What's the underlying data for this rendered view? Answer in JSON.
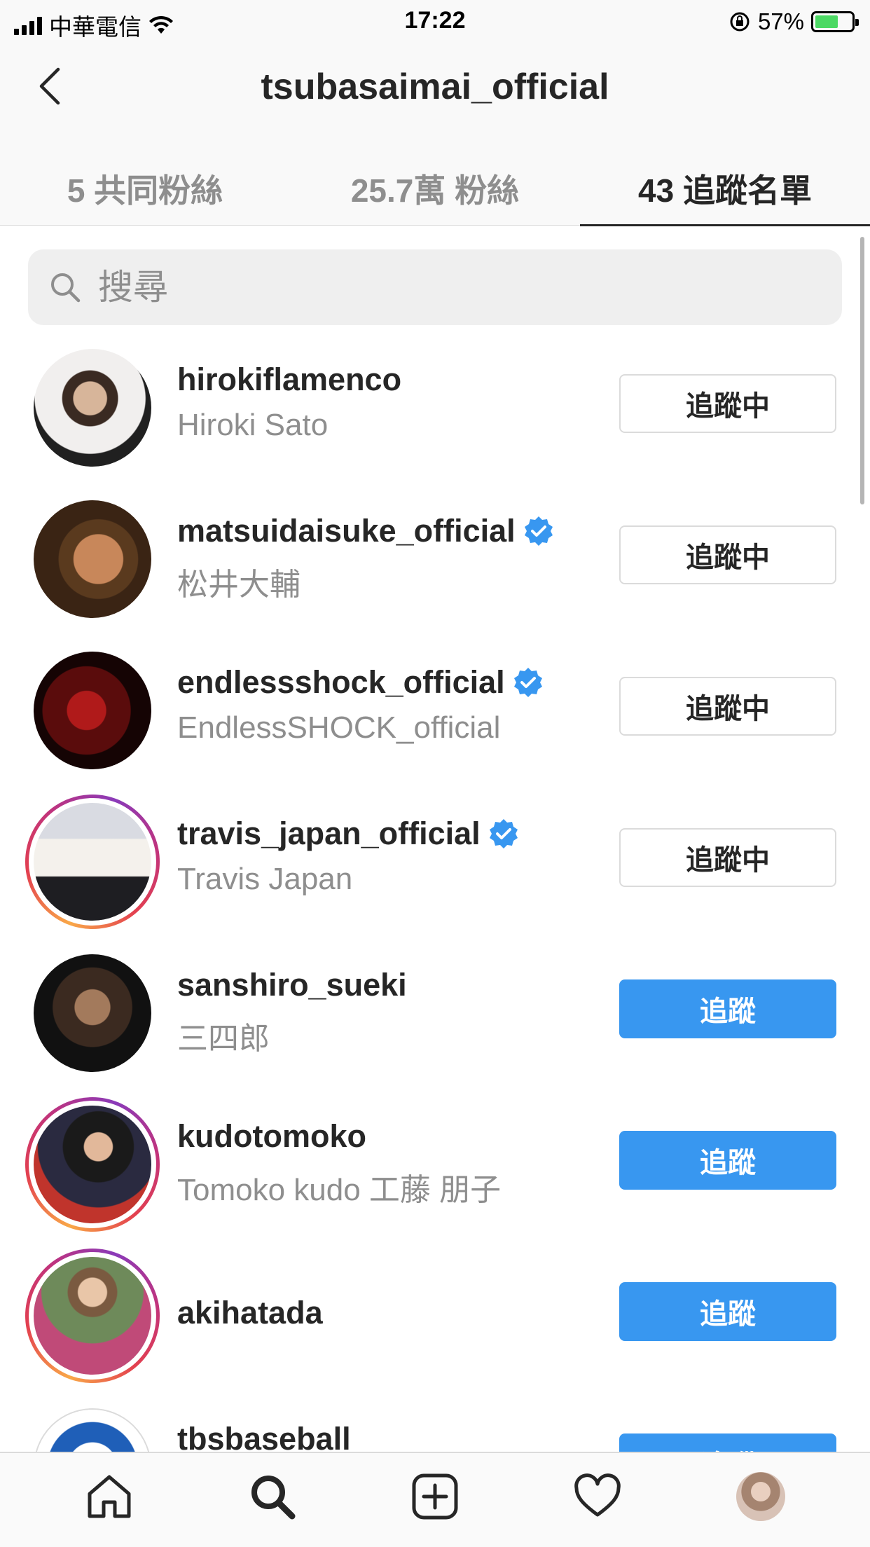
{
  "status_bar": {
    "carrier": "中華電信",
    "time": "17:22",
    "battery": "57%"
  },
  "header": {
    "title": "tsubasaimai_official",
    "tabs": [
      {
        "label": "5 共同粉絲"
      },
      {
        "label": "25.7萬 粉絲"
      },
      {
        "label": "43 追蹤名單"
      }
    ]
  },
  "search": {
    "placeholder": "搜尋"
  },
  "accounts": [
    {
      "username": "hirokiflamenco",
      "full_name": "Hiroki Sato",
      "verified": false,
      "button": "追蹤中"
    },
    {
      "username": "matsuidaisuke_official",
      "full_name": "松井大輔",
      "verified": true,
      "button": "追蹤中"
    },
    {
      "username": "endlessshock_official",
      "full_name": "EndlessSHOCK_official",
      "verified": true,
      "button": "追蹤中"
    },
    {
      "username": "travis_japan_official",
      "full_name": "Travis Japan",
      "verified": true,
      "button": "追蹤中"
    },
    {
      "username": "sanshiro_sueki",
      "full_name": "三四郎",
      "verified": false,
      "button": "追蹤"
    },
    {
      "username": "kudotomoko",
      "full_name": "Tomoko kudo 工藤 朋子",
      "verified": false,
      "button": "追蹤"
    },
    {
      "username": "akihatada",
      "full_name": "",
      "verified": false,
      "button": "追蹤"
    },
    {
      "username": "tbsbaseball",
      "full_name": "",
      "verified": false,
      "button": "追蹤"
    }
  ],
  "nav": [
    "home-icon",
    "search-icon",
    "add-post-icon",
    "activity-heart-icon",
    "profile-avatar"
  ],
  "colors": {
    "follow_blue": "#3897f0",
    "verified_blue": "#3897f0",
    "text": "#262626",
    "secondary_text": "#8e8e8e"
  }
}
